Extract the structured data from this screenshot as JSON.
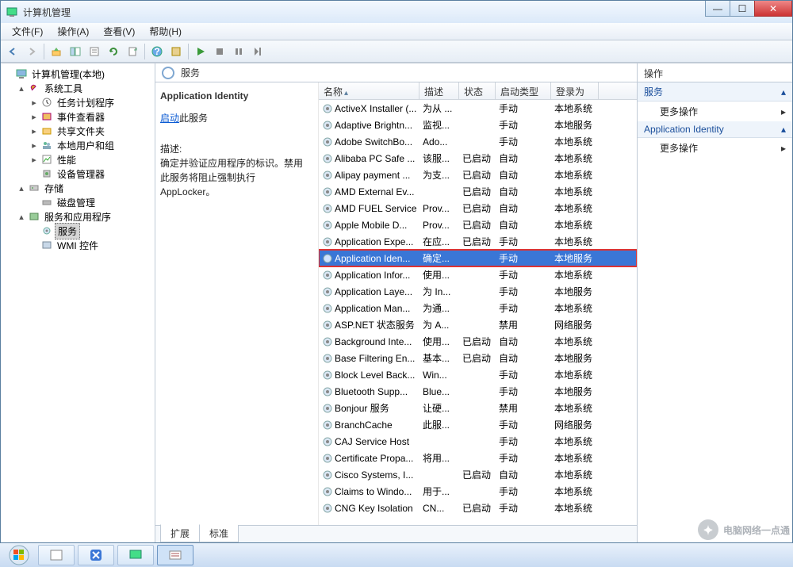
{
  "window": {
    "title": "计算机管理",
    "shadow_text": ""
  },
  "menu": {
    "file": "文件(F)",
    "action": "操作(A)",
    "view": "查看(V)",
    "help": "帮助(H)"
  },
  "tree": {
    "root": "计算机管理(本地)",
    "systools": "系统工具",
    "taskscheduler": "任务计划程序",
    "eventviewer": "事件查看器",
    "sharedfolders": "共享文件夹",
    "localusers": "本地用户和组",
    "performance": "性能",
    "devicemgr": "设备管理器",
    "storage": "存储",
    "diskmgmt": "磁盘管理",
    "servicesapps": "服务和应用程序",
    "services": "服务",
    "wmi": "WMI 控件"
  },
  "mid": {
    "header": "服务",
    "selected_name": "Application Identity",
    "start_link": "启动",
    "start_suffix": "此服务",
    "desc_label": "描述:",
    "desc_text": "确定并验证应用程序的标识。禁用此服务将阻止强制执行 AppLocker。",
    "tabs": {
      "extended": "扩展",
      "standard": "标准"
    }
  },
  "columns": {
    "name": "名称",
    "desc": "描述",
    "status": "状态",
    "startup": "启动类型",
    "logon": "登录为"
  },
  "rows": [
    {
      "name": "ActiveX Installer (...",
      "desc": "为从 ...",
      "status": "",
      "startup": "手动",
      "logon": "本地系统"
    },
    {
      "name": "Adaptive Brightn...",
      "desc": "监视...",
      "status": "",
      "startup": "手动",
      "logon": "本地服务"
    },
    {
      "name": "Adobe SwitchBo...",
      "desc": "Ado...",
      "status": "",
      "startup": "手动",
      "logon": "本地系统"
    },
    {
      "name": "Alibaba PC Safe ...",
      "desc": "该服...",
      "status": "已启动",
      "startup": "自动",
      "logon": "本地系统"
    },
    {
      "name": "Alipay payment ...",
      "desc": "为支...",
      "status": "已启动",
      "startup": "自动",
      "logon": "本地系统"
    },
    {
      "name": "AMD External Ev...",
      "desc": "",
      "status": "已启动",
      "startup": "自动",
      "logon": "本地系统"
    },
    {
      "name": "AMD FUEL Service",
      "desc": "Prov...",
      "status": "已启动",
      "startup": "自动",
      "logon": "本地系统"
    },
    {
      "name": "Apple Mobile D...",
      "desc": "Prov...",
      "status": "已启动",
      "startup": "自动",
      "logon": "本地系统"
    },
    {
      "name": "Application Expe...",
      "desc": "在应...",
      "status": "已启动",
      "startup": "手动",
      "logon": "本地系统"
    },
    {
      "name": "Application Iden...",
      "desc": "确定...",
      "status": "",
      "startup": "手动",
      "logon": "本地服务",
      "selected": true
    },
    {
      "name": "Application Infor...",
      "desc": "使用...",
      "status": "",
      "startup": "手动",
      "logon": "本地系统"
    },
    {
      "name": "Application Laye...",
      "desc": "为 In...",
      "status": "",
      "startup": "手动",
      "logon": "本地服务"
    },
    {
      "name": "Application Man...",
      "desc": "为通...",
      "status": "",
      "startup": "手动",
      "logon": "本地系统"
    },
    {
      "name": "ASP.NET 状态服务",
      "desc": "为 A...",
      "status": "",
      "startup": "禁用",
      "logon": "网络服务"
    },
    {
      "name": "Background Inte...",
      "desc": "使用...",
      "status": "已启动",
      "startup": "自动",
      "logon": "本地系统"
    },
    {
      "name": "Base Filtering En...",
      "desc": "基本...",
      "status": "已启动",
      "startup": "自动",
      "logon": "本地服务"
    },
    {
      "name": "Block Level Back...",
      "desc": "Win...",
      "status": "",
      "startup": "手动",
      "logon": "本地系统"
    },
    {
      "name": "Bluetooth Supp...",
      "desc": "Blue...",
      "status": "",
      "startup": "手动",
      "logon": "本地服务"
    },
    {
      "name": "Bonjour 服务",
      "desc": "让硬...",
      "status": "",
      "startup": "禁用",
      "logon": "本地系统"
    },
    {
      "name": "BranchCache",
      "desc": "此服...",
      "status": "",
      "startup": "手动",
      "logon": "网络服务"
    },
    {
      "name": "CAJ Service Host",
      "desc": "",
      "status": "",
      "startup": "手动",
      "logon": "本地系统"
    },
    {
      "name": "Certificate Propa...",
      "desc": "将用...",
      "status": "",
      "startup": "手动",
      "logon": "本地系统"
    },
    {
      "name": "Cisco Systems, I...",
      "desc": "",
      "status": "已启动",
      "startup": "自动",
      "logon": "本地系统"
    },
    {
      "name": "Claims to Windo...",
      "desc": "用于...",
      "status": "",
      "startup": "手动",
      "logon": "本地系统"
    },
    {
      "name": "CNG Key Isolation",
      "desc": "CN...",
      "status": "已启动",
      "startup": "手动",
      "logon": "本地系统"
    }
  ],
  "actions": {
    "title": "操作",
    "section1": "服务",
    "more": "更多操作",
    "section2": "Application Identity"
  },
  "watermark": "电脑网络一点通"
}
